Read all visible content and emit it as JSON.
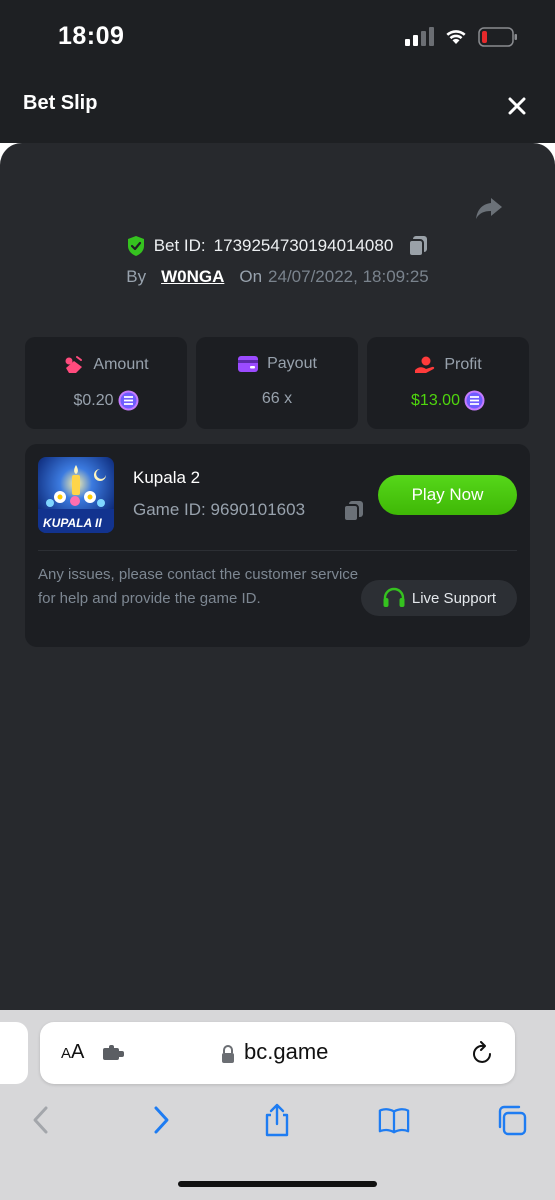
{
  "status_bar": {
    "time": "18:09",
    "icons": [
      "signal-icon",
      "wifi-icon",
      "battery-low-icon"
    ],
    "battery_color": "#e5292b"
  },
  "header": {
    "title": "Bet Slip",
    "close_icon": "close-icon"
  },
  "bet": {
    "id_label": "Bet ID:",
    "id": "1739254730194014080",
    "by_label": "By",
    "user": "W0NGA",
    "on_label": "On",
    "date": "24/07/2022, 18:09:25"
  },
  "stats": [
    {
      "label": "Amount",
      "value": "$0.20",
      "icon": "amount-icon",
      "has_coin": true,
      "color": "#ff4b7d"
    },
    {
      "label": "Payout",
      "value": "66 x",
      "icon": "payout-icon",
      "has_coin": false,
      "color": "#9b4bff"
    },
    {
      "label": "Profit",
      "value": "$13.00",
      "icon": "profit-icon",
      "has_coin": true,
      "color": "#ff3b3b"
    }
  ],
  "game": {
    "name": "Kupala 2",
    "thumb_text": "KUPALA II",
    "id_label": "Game ID:",
    "id": "9690101603",
    "play_label": "Play Now",
    "issue_text": "Any issues, please contact the customer service for help and provide the game ID.",
    "support_label": "Live Support"
  },
  "colors": {
    "accent_green": "#4fd50e",
    "panel": "#27292d",
    "card": "#1c1e22"
  },
  "browser": {
    "aa_label_small": "A",
    "aa_label_large": "A",
    "url": "bc.game"
  }
}
